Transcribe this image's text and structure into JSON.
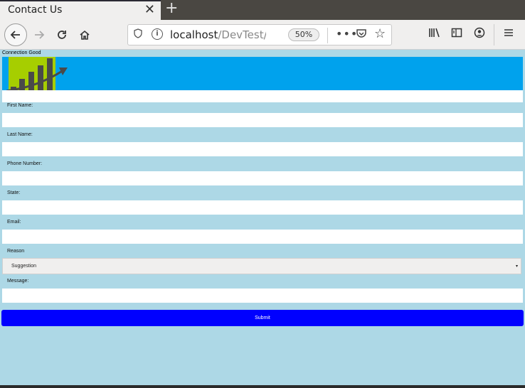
{
  "browser": {
    "tab_title": "Contact Us",
    "tab_close": "✕",
    "new_tab": "+",
    "url_host": "localhost",
    "url_path": "/DevTest/c",
    "zoom": "50%"
  },
  "page": {
    "connection_status": "Connection Good",
    "fields": {
      "first_name_label": "First Name:",
      "last_name_label": "Last Name:",
      "phone_label": "Phone Number:",
      "state_label": "State:",
      "email_label": "Email:",
      "reason_label": "Reason",
      "reason_selected": "Suggestion",
      "message_label": "Message:"
    },
    "submit_label": "Submit"
  },
  "colors": {
    "page_bg": "#add8e6",
    "banner": "#00a2ed",
    "submit": "#0000ff",
    "logo_green": "#a6ce00"
  }
}
